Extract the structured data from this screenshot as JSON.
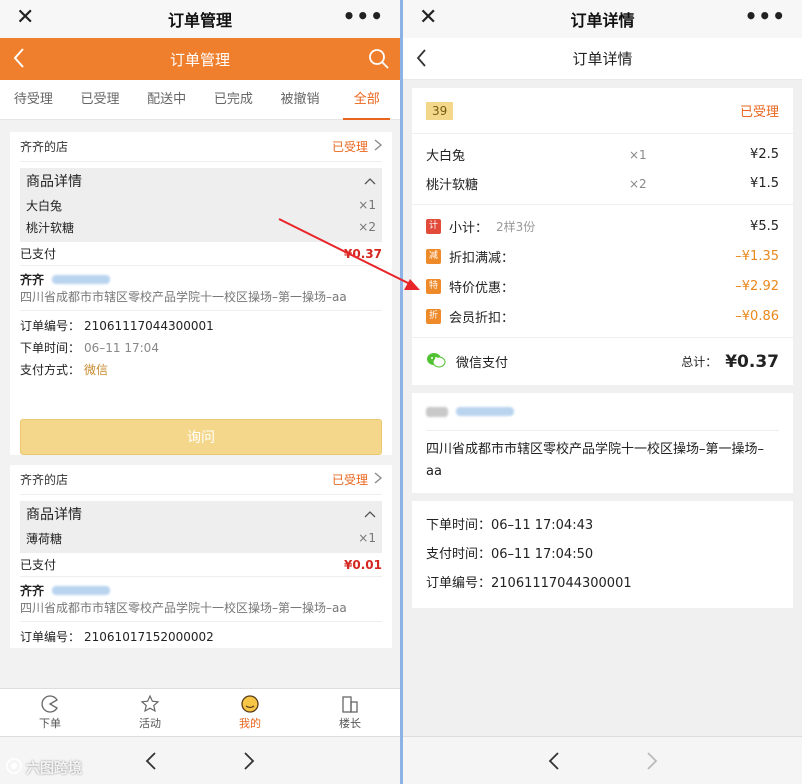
{
  "left": {
    "title": "订单管理",
    "header_title": "订单管理",
    "tabs": [
      {
        "label": "待受理"
      },
      {
        "label": "已受理"
      },
      {
        "label": "配送中"
      },
      {
        "label": "已完成"
      },
      {
        "label": "被撤销"
      },
      {
        "label": "全部"
      }
    ],
    "orders": [
      {
        "shop": "齐齐的店",
        "status": "已受理",
        "goods_title": "商品详情",
        "items": [
          {
            "name": "大白兔",
            "qty": "×1"
          },
          {
            "name": "桃汁软糖",
            "qty": "×2"
          }
        ],
        "paid_label": "已支付",
        "amount": "¥0.37",
        "buyer": "齐齐",
        "address": "四川省成都市市辖区零校产品学院十一校区操场–第一操场–aa",
        "order_no_label": "订单编号：",
        "order_no": "21061117044300001",
        "time_label": "下单时间：",
        "time": "06–11 17:04",
        "pay_label": "支付方式：",
        "pay_method": "微信",
        "ask_button": "询问"
      },
      {
        "shop": "齐齐的店",
        "status": "已受理",
        "goods_title": "商品详情",
        "items": [
          {
            "name": "薄荷糖",
            "qty": "×1"
          }
        ],
        "paid_label": "已支付",
        "amount": "¥0.01",
        "buyer": "齐齐",
        "address": "四川省成都市市辖区零校产品学院十一校区操场–第一操场–aa",
        "order_no_label": "订单编号：",
        "order_no": "21061017152000002"
      }
    ],
    "nav": [
      {
        "label": "下单"
      },
      {
        "label": "活动"
      },
      {
        "label": "我的"
      },
      {
        "label": "楼长"
      }
    ],
    "watermark": "六图跨境"
  },
  "right": {
    "title": "订单详情",
    "header_title": "订单详情",
    "badge": "39",
    "status": "已受理",
    "items": [
      {
        "name": "大白兔",
        "qty": "×1",
        "price": "¥2.5"
      },
      {
        "name": "桃汁软糖",
        "qty": "×2",
        "price": "¥1.5"
      }
    ],
    "fees": [
      {
        "icon": "计",
        "label": "小计：",
        "sub": "2样3份",
        "value": "¥5.5",
        "color": "#e24b3a"
      },
      {
        "icon": "减",
        "label": "折扣满减：",
        "sub": "",
        "value": "–¥1.35",
        "color": "#ef8a2a"
      },
      {
        "icon": "特",
        "label": "特价优惠：",
        "sub": "",
        "value": "–¥2.92",
        "color": "#ef8a2a"
      },
      {
        "icon": "折",
        "label": "会员折扣：",
        "sub": "",
        "value": "–¥0.86",
        "color": "#ef8a2a"
      }
    ],
    "pay_method": "微信支付",
    "total_label": "总计：",
    "total": "¥0.37",
    "address": "四川省成都市市辖区零校产品学院十一校区操场–第一操场–aa",
    "times": [
      {
        "label": "下单时间：",
        "value": "06–11 17:04:43"
      },
      {
        "label": "支付时间：",
        "value": "06–11 17:04:50"
      },
      {
        "label": "订单编号：",
        "value": "21061117044300001"
      }
    ]
  },
  "colors": {
    "brand": "#f07f2d",
    "accent": "#e9651d",
    "price_red": "#d3271f",
    "arrow": "#e8262a"
  }
}
